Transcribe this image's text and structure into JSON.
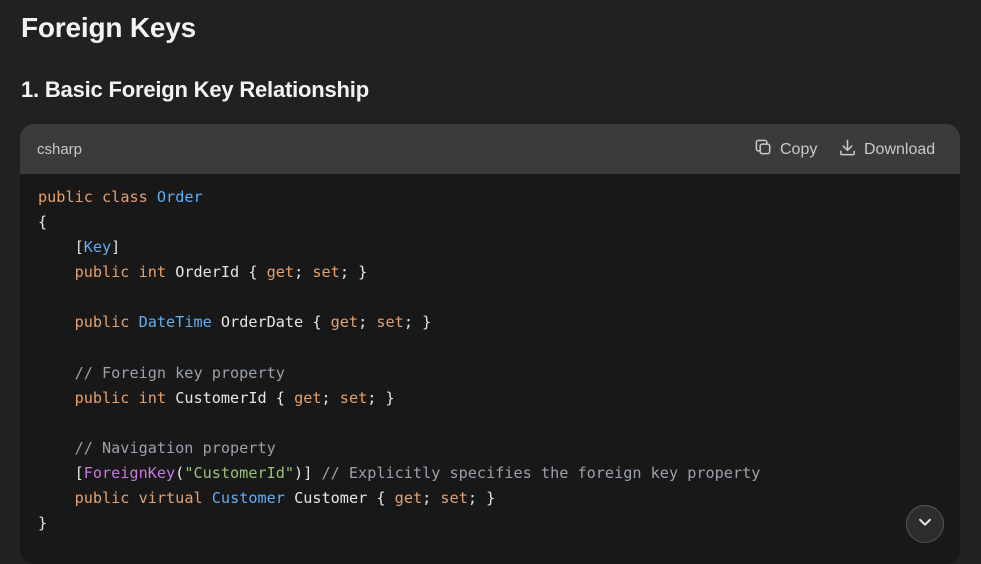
{
  "heading": "Foreign Keys",
  "subheading": "1. Basic Foreign Key Relationship",
  "code_block": {
    "language": "csharp",
    "copy_label": "Copy",
    "download_label": "Download",
    "lines": [
      [
        {
          "t": "kw",
          "v": "public"
        },
        {
          "t": "",
          "v": " "
        },
        {
          "t": "kw",
          "v": "class"
        },
        {
          "t": "",
          "v": " "
        },
        {
          "t": "ty",
          "v": "Order"
        }
      ],
      [
        {
          "t": "",
          "v": "{"
        }
      ],
      [
        {
          "t": "",
          "v": "    ["
        },
        {
          "t": "ty",
          "v": "Key"
        },
        {
          "t": "",
          "v": "]"
        }
      ],
      [
        {
          "t": "",
          "v": "    "
        },
        {
          "t": "kw",
          "v": "public"
        },
        {
          "t": "",
          "v": " "
        },
        {
          "t": "kw",
          "v": "int"
        },
        {
          "t": "",
          "v": " OrderId { "
        },
        {
          "t": "kw",
          "v": "get"
        },
        {
          "t": "",
          "v": "; "
        },
        {
          "t": "kw",
          "v": "set"
        },
        {
          "t": "",
          "v": "; }"
        }
      ],
      [
        {
          "t": "",
          "v": ""
        }
      ],
      [
        {
          "t": "",
          "v": "    "
        },
        {
          "t": "kw",
          "v": "public"
        },
        {
          "t": "",
          "v": " "
        },
        {
          "t": "ty",
          "v": "DateTime"
        },
        {
          "t": "",
          "v": " OrderDate { "
        },
        {
          "t": "kw",
          "v": "get"
        },
        {
          "t": "",
          "v": "; "
        },
        {
          "t": "kw",
          "v": "set"
        },
        {
          "t": "",
          "v": "; }"
        }
      ],
      [
        {
          "t": "",
          "v": ""
        }
      ],
      [
        {
          "t": "",
          "v": "    "
        },
        {
          "t": "cm",
          "v": "// Foreign key property"
        }
      ],
      [
        {
          "t": "",
          "v": "    "
        },
        {
          "t": "kw",
          "v": "public"
        },
        {
          "t": "",
          "v": " "
        },
        {
          "t": "kw",
          "v": "int"
        },
        {
          "t": "",
          "v": " CustomerId { "
        },
        {
          "t": "kw",
          "v": "get"
        },
        {
          "t": "",
          "v": "; "
        },
        {
          "t": "kw",
          "v": "set"
        },
        {
          "t": "",
          "v": "; }"
        }
      ],
      [
        {
          "t": "",
          "v": ""
        }
      ],
      [
        {
          "t": "",
          "v": "    "
        },
        {
          "t": "cm",
          "v": "// Navigation property"
        }
      ],
      [
        {
          "t": "",
          "v": "    ["
        },
        {
          "t": "at",
          "v": "ForeignKey"
        },
        {
          "t": "",
          "v": "("
        },
        {
          "t": "st",
          "v": "\"CustomerId\""
        },
        {
          "t": "",
          "v": ")] "
        },
        {
          "t": "cm",
          "v": "// Explicitly specifies the foreign key property"
        }
      ],
      [
        {
          "t": "",
          "v": "    "
        },
        {
          "t": "kw",
          "v": "public"
        },
        {
          "t": "",
          "v": " "
        },
        {
          "t": "kw",
          "v": "virtual"
        },
        {
          "t": "",
          "v": " "
        },
        {
          "t": "ty",
          "v": "Customer"
        },
        {
          "t": "",
          "v": " Customer { "
        },
        {
          "t": "kw",
          "v": "get"
        },
        {
          "t": "",
          "v": "; "
        },
        {
          "t": "kw",
          "v": "set"
        },
        {
          "t": "",
          "v": "; }"
        }
      ],
      [
        {
          "t": "",
          "v": "}"
        }
      ]
    ]
  },
  "colors": {
    "keyword": "#e5a06d",
    "type": "#5eaef5",
    "comment": "#9aa1ac",
    "string": "#98c379",
    "attribute": "#c678dd"
  },
  "icons": {
    "copy": "copy-icon",
    "download": "download-icon",
    "scroll": "chevron-down-icon"
  }
}
